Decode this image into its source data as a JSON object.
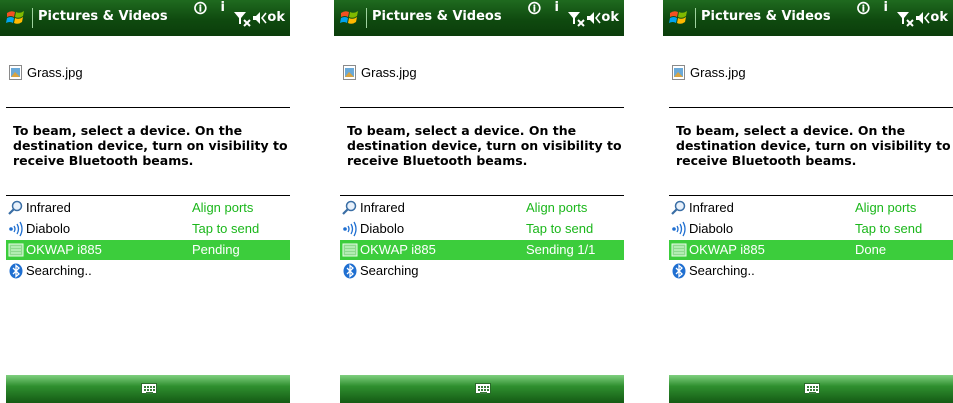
{
  "screens": [
    {
      "title": "Pictures & Videos",
      "ok_label": "ok",
      "file_name": "Grass.jpg",
      "instruction": "To beam, select a device. On the destination device, turn on visibility to receive Bluetooth beams.",
      "devices": [
        {
          "name": "Infrared",
          "status": "Align ports",
          "icon": "magnifier-icon",
          "selected": false
        },
        {
          "name": "Diabolo",
          "status": "Tap to send",
          "icon": "bluetooth-waves-icon",
          "selected": false
        },
        {
          "name": "OKWAP i885",
          "status": "Pending",
          "icon": "phone-device-icon",
          "selected": true
        },
        {
          "name": "Searching..",
          "status": "",
          "icon": "bluetooth-icon",
          "selected": false
        }
      ]
    },
    {
      "title": "Pictures & Videos",
      "ok_label": "ok",
      "file_name": "Grass.jpg",
      "instruction": "To beam, select a device. On the destination device, turn on visibility to receive Bluetooth beams.",
      "devices": [
        {
          "name": "Infrared",
          "status": "Align ports",
          "icon": "magnifier-icon",
          "selected": false
        },
        {
          "name": "Diabolo",
          "status": "Tap to send",
          "icon": "bluetooth-waves-icon",
          "selected": false
        },
        {
          "name": "OKWAP i885",
          "status": "Sending 1/1",
          "icon": "phone-device-icon",
          "selected": true
        },
        {
          "name": "Searching",
          "status": "",
          "icon": "bluetooth-icon",
          "selected": false
        }
      ]
    },
    {
      "title": "Pictures & Videos",
      "ok_label": "ok",
      "file_name": "Grass.jpg",
      "instruction": "To beam, select a device. On the destination device, turn on visibility to receive Bluetooth beams.",
      "devices": [
        {
          "name": "Infrared",
          "status": "Align ports",
          "icon": "magnifier-icon",
          "selected": false
        },
        {
          "name": "Diabolo",
          "status": "Tap to send",
          "icon": "bluetooth-waves-icon",
          "selected": false
        },
        {
          "name": "OKWAP i885",
          "status": "Done",
          "icon": "phone-device-icon",
          "selected": true
        },
        {
          "name": "Searching..",
          "status": "",
          "icon": "bluetooth-icon",
          "selected": false
        }
      ]
    }
  ],
  "colors": {
    "title_bar": "#0f4a0f",
    "selected_row": "#3ccd3c",
    "status_text": "#1bb71b",
    "bottom_bar": "#2f8f2f"
  }
}
